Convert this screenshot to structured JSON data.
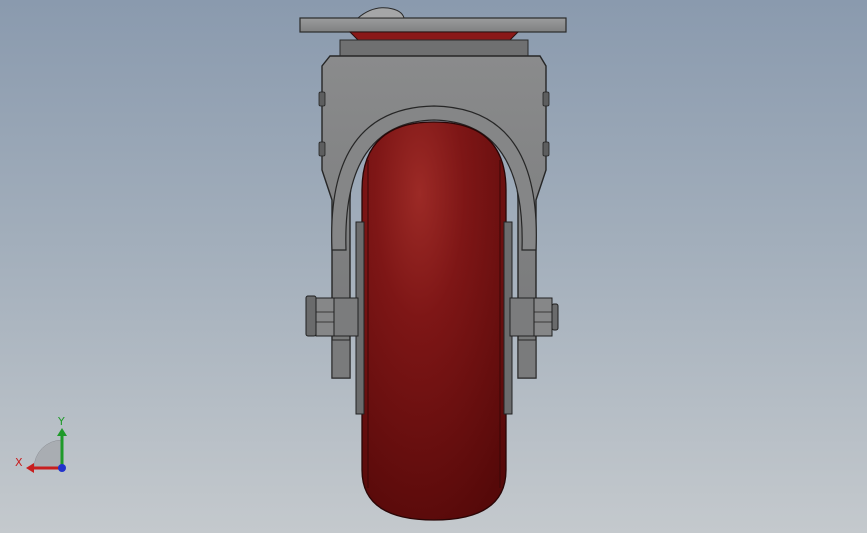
{
  "viewport": {
    "background_top": "#8a9aae",
    "background_bottom": "#c4c9cd"
  },
  "model": {
    "description_icon": "caster-wheel-front-view",
    "wheel_color": "#7a1515",
    "bracket_color": "#7d7e7f"
  },
  "triad": {
    "x_label": "X",
    "y_label": "Y",
    "x_color": "#c81e1e",
    "y_color": "#1f9a2a",
    "z_color": "#2233cc"
  }
}
